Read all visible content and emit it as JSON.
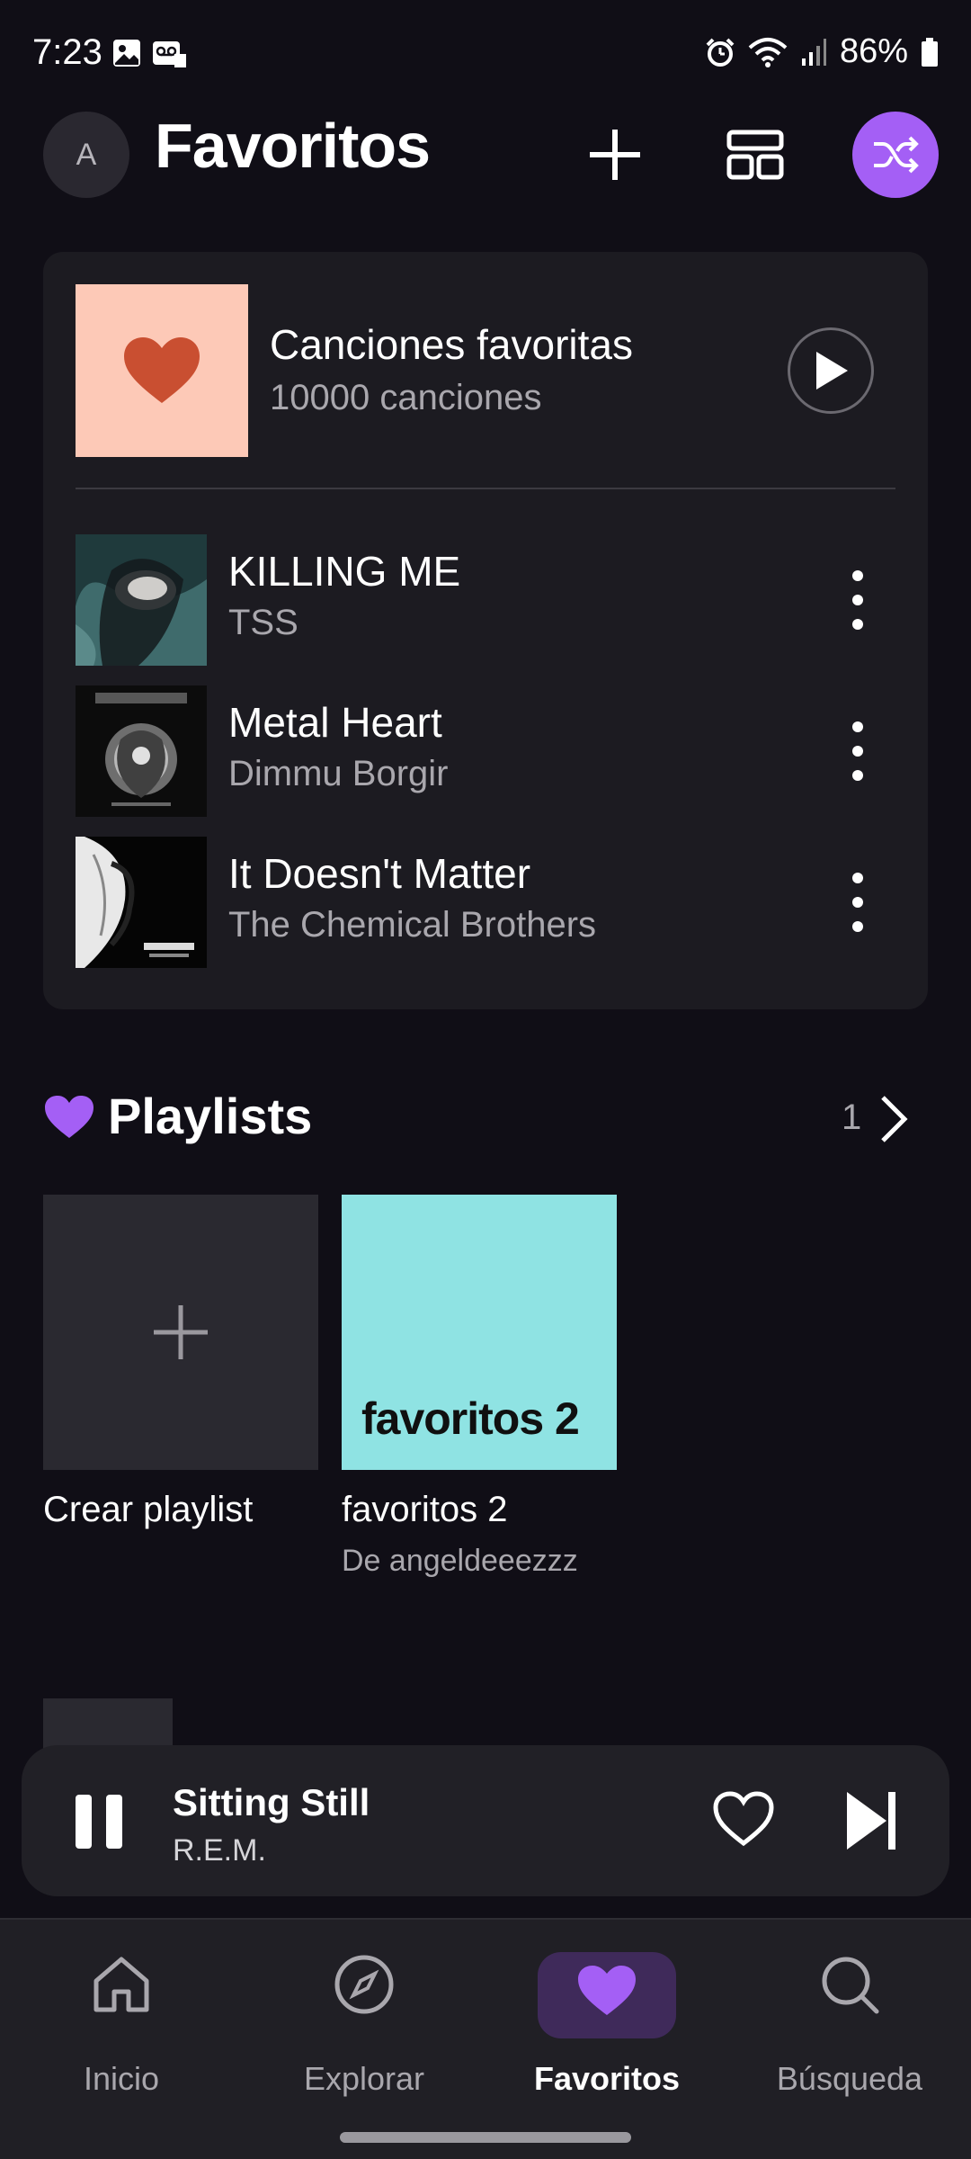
{
  "status_bar": {
    "time": "7:23",
    "battery": "86%"
  },
  "header": {
    "avatar_letter": "A",
    "title": "Favoritos",
    "accent_color": "#a45ff5"
  },
  "favorites_card": {
    "title": "Canciones favoritas",
    "count": "10000 canciones",
    "tracks": [
      {
        "title": "KILLING ME",
        "artist": "TSS"
      },
      {
        "title": "Metal Heart",
        "artist": "Dimmu Borgir"
      },
      {
        "title": "It Doesn't Matter",
        "artist": "The Chemical Brothers"
      }
    ]
  },
  "playlists": {
    "title": "Playlists",
    "count": "1",
    "items": [
      {
        "label": "Crear playlist"
      },
      {
        "label": "favoritos 2",
        "cover_text": "favoritos 2",
        "subtitle": "De angeldeeezzz"
      }
    ]
  },
  "mini_player": {
    "title": "Sitting Still",
    "artist": "R.E.M."
  },
  "bottom_nav": {
    "items": [
      {
        "label": "Inicio",
        "icon": "home-icon"
      },
      {
        "label": "Explorar",
        "icon": "compass-icon"
      },
      {
        "label": "Favoritos",
        "icon": "heart-icon",
        "active": true
      },
      {
        "label": "Búsqueda",
        "icon": "search-icon"
      }
    ]
  }
}
